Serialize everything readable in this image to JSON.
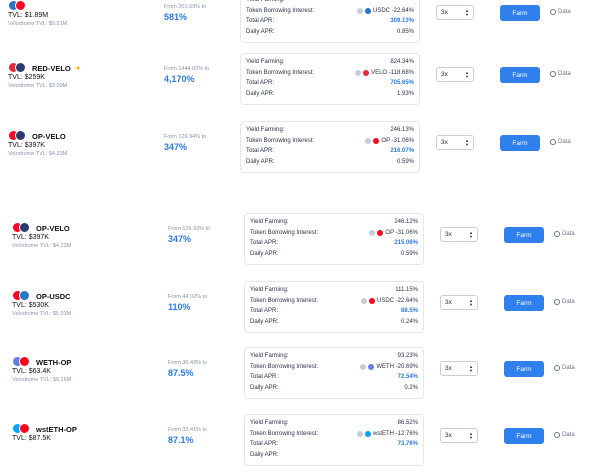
{
  "labels": {
    "yield": "Yield Farming:",
    "borrow": "Token Borrowing Interest:",
    "total": "Total APR:",
    "daily": "Daily APR:",
    "farm": "Farm",
    "data": "Data",
    "leverage": "3x"
  },
  "rows": [
    {
      "pair": "",
      "tvl": "TVL: $1.89M",
      "vtvl": "Velodrome TVL: $9.91M",
      "from": "From 201.69% to",
      "apr": "581%",
      "yield": "",
      "borrow_token": "USDC",
      "borrow": "USDC -22.64%",
      "total": "309.13%",
      "daily": "0.85%",
      "coin_a": "#2775ca",
      "coin_b": "#ff0420"
    },
    {
      "pair": "RED-VELO",
      "tvl": "TVL: $259K",
      "vtvl": "Velodrome TVL: $3.09M",
      "from": "From 1444.83% to",
      "apr": "4,170%",
      "yield": "824.34%",
      "borrow_token": "VELO",
      "borrow": "VELO -118.68%",
      "total": "705.65%",
      "daily": "1.93%",
      "coin_a": "#e5293a",
      "coin_b": "#2a3a6e"
    },
    {
      "pair": "OP-VELO",
      "tvl": "TVL: $397K",
      "vtvl": "Velodrome TVL: $4.23M",
      "from": "From 126.94% to",
      "apr": "347%",
      "yield": "246.13%",
      "borrow_token": "OP",
      "borrow": "OP -31.06%",
      "total": "216.07%",
      "daily": "0.59%",
      "coin_a": "#ff0420",
      "coin_b": "#2a3a6e"
    },
    {
      "pair": "OP-VELO",
      "tvl": "TVL: $397K",
      "vtvl": "Velodrome TVL: $4.23M",
      "from": "From 126.93% to",
      "apr": "347%",
      "yield": "246.12%",
      "borrow_token": "OP",
      "borrow": "OP -31.06%",
      "total": "215.06%",
      "daily": "0.59%",
      "coin_a": "#ff0420",
      "coin_b": "#2a3a6e"
    },
    {
      "pair": "OP-USDC",
      "tvl": "TVL: $530K",
      "vtvl": "Velodrome TVL: $5.03M",
      "from": "From 44.02% to",
      "apr": "110%",
      "yield": "111.15%",
      "borrow_token": "USDC",
      "borrow": "USDC -22.64%",
      "total": "88.5%",
      "daily": "0.24%",
      "coin_a": "#ff0420",
      "coin_b": "#2775ca"
    },
    {
      "pair": "WETH-OP",
      "tvl": "TVL: $63.4K",
      "vtvl": "Velodrome TVL: $9.16M",
      "from": "From 36.43% to",
      "apr": "87.5%",
      "yield": "93.23%",
      "borrow_token": "WETH",
      "borrow": "WETH -20.69%",
      "total": "72.54%",
      "daily": "0.2%",
      "coin_a": "#627eea",
      "coin_b": "#ff0420"
    },
    {
      "pair": "wstETH-OP",
      "tvl": "TVL: $87.5K",
      "vtvl": "",
      "from": "From 33.41% to",
      "apr": "87.1%",
      "yield": "86.52%",
      "borrow_token": "wstETH",
      "borrow": "wstETH -12.76%",
      "total": "73.76%",
      "daily": "",
      "coin_a": "#00a3ff",
      "coin_b": "#ff0420"
    }
  ]
}
